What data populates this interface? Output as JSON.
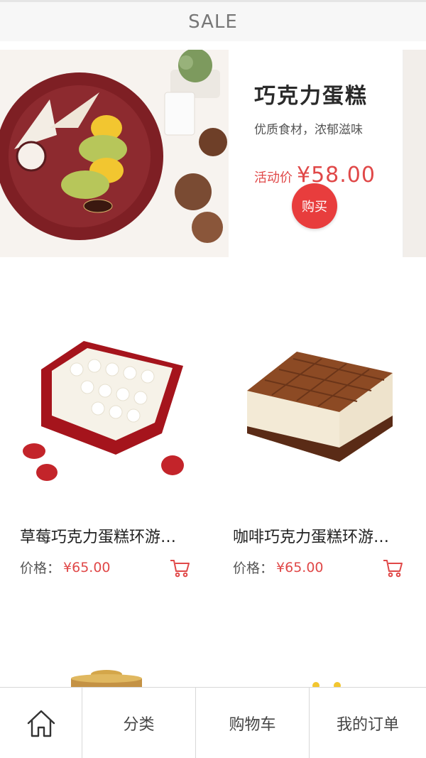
{
  "header": {
    "title": "SALE"
  },
  "banner": {
    "name": "巧克力蛋糕",
    "subtitle": "优质食材，浓郁滋味",
    "price_label": "活动价",
    "price": "¥58.00",
    "buy_label": "购买",
    "slide_count": 4,
    "active_slide": 3
  },
  "products": [
    {
      "name": "草莓巧克力蛋糕环游…",
      "price_label": "价格：",
      "price": "¥65.00"
    },
    {
      "name": "咖啡巧克力蛋糕环游…",
      "price_label": "价格：",
      "price": "¥65.00"
    }
  ],
  "bottom_nav": {
    "home_icon": "home-icon",
    "category": "分类",
    "cart": "购物车",
    "orders": "我的订单"
  },
  "colors": {
    "accent": "#e04848",
    "buy_button": "#e83d3d"
  }
}
